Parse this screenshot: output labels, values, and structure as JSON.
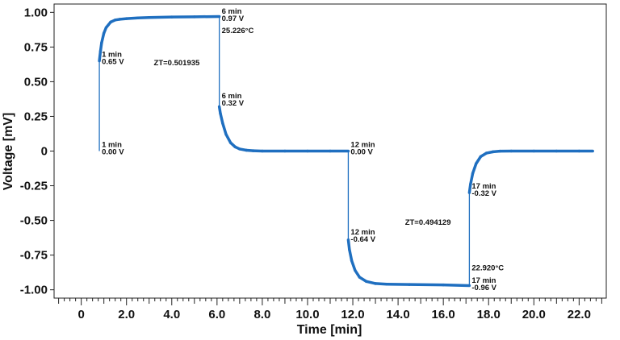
{
  "chart_data": {
    "type": "line",
    "title": "",
    "xlabel": "Time [min]",
    "ylabel": "Voltage [mV]",
    "xlim": [
      -1.2,
      23.2
    ],
    "ylim": [
      -1.06,
      1.06
    ],
    "x_ticks": [
      {
        "v": 0,
        "label": "0"
      },
      {
        "v": 2,
        "label": "2.0"
      },
      {
        "v": 4,
        "label": "4.0"
      },
      {
        "v": 6,
        "label": "6.0"
      },
      {
        "v": 8,
        "label": "8.0"
      },
      {
        "v": 10,
        "label": "10.0"
      },
      {
        "v": 12,
        "label": "12.0"
      },
      {
        "v": 14,
        "label": "14.0"
      },
      {
        "v": 16,
        "label": "16.0"
      },
      {
        "v": 18,
        "label": "18.0"
      },
      {
        "v": 20,
        "label": "20.0"
      },
      {
        "v": 22,
        "label": "22.0"
      }
    ],
    "y_ticks": [
      {
        "v": 1.0,
        "label": "1.00"
      },
      {
        "v": 0.75,
        "label": "0.75"
      },
      {
        "v": 0.5,
        "label": "0.50"
      },
      {
        "v": 0.25,
        "label": "0.25"
      },
      {
        "v": 0,
        "label": "0"
      },
      {
        "v": -0.25,
        "label": "-0.25"
      },
      {
        "v": -0.5,
        "label": "-0.50"
      },
      {
        "v": -0.75,
        "label": "-0.75"
      },
      {
        "v": -1.0,
        "label": "-1.00"
      }
    ],
    "grid": false,
    "color": "#1f6fc0",
    "series": [
      {
        "x": [
          0.8,
          0.8,
          0.85,
          0.9,
          1.0,
          1.1,
          1.2,
          1.3,
          1.5,
          1.7,
          2.0,
          2.5,
          3.0,
          4.0,
          5.0,
          6.1,
          6.1,
          6.15,
          6.25,
          6.4,
          6.6,
          6.8,
          7.0,
          7.3,
          7.6,
          8.0,
          9.0,
          10.0,
          11.0,
          11.8,
          11.8,
          11.85,
          11.95,
          12.1,
          12.3,
          12.6,
          13.0,
          13.5,
          14.5,
          16.0,
          17.15,
          17.15,
          17.2,
          17.3,
          17.45,
          17.65,
          17.9,
          18.2,
          18.5,
          19.0,
          20.0,
          21.0,
          22.0,
          22.6
        ],
        "y": [
          0.0,
          0.65,
          0.72,
          0.78,
          0.85,
          0.89,
          0.91,
          0.93,
          0.945,
          0.95,
          0.955,
          0.96,
          0.963,
          0.966,
          0.968,
          0.97,
          0.32,
          0.27,
          0.2,
          0.12,
          0.06,
          0.03,
          0.015,
          0.006,
          0.002,
          0.0,
          0.0,
          0.0,
          0.0,
          0.0,
          -0.64,
          -0.71,
          -0.79,
          -0.86,
          -0.91,
          -0.94,
          -0.955,
          -0.96,
          -0.962,
          -0.965,
          -0.97,
          -0.3,
          -0.24,
          -0.16,
          -0.09,
          -0.04,
          -0.015,
          -0.005,
          -0.001,
          0.0,
          0.0,
          0.0,
          0.0,
          0.0
        ]
      }
    ],
    "annotations": [
      {
        "x": 0.8,
        "y": 0.68,
        "lines": [
          "1 min",
          "0.65 V"
        ]
      },
      {
        "x": 0.8,
        "y": 0.03,
        "lines": [
          "1 min",
          "0.00 V"
        ]
      },
      {
        "x": 6.1,
        "y": 0.99,
        "lines": [
          "6 min",
          "0.97 V"
        ]
      },
      {
        "x": 6.1,
        "y": 0.85,
        "lines": [
          "25.226°C"
        ]
      },
      {
        "x": 6.1,
        "y": 0.38,
        "lines": [
          "6 min",
          "0.32 V"
        ]
      },
      {
        "x": 3.1,
        "y": 0.62,
        "lines": [
          "ZT=0.501935"
        ]
      },
      {
        "x": 11.8,
        "y": 0.03,
        "lines": [
          "12 min",
          "0.00 V"
        ]
      },
      {
        "x": 11.8,
        "y": -0.6,
        "lines": [
          "12 min",
          "-0.64 V"
        ]
      },
      {
        "x": 14.2,
        "y": -0.53,
        "lines": [
          "ZT=0.494129"
        ]
      },
      {
        "x": 17.15,
        "y": -0.27,
        "lines": [
          "17 min",
          "-0.32 V"
        ]
      },
      {
        "x": 17.15,
        "y": -0.86,
        "lines": [
          "22.920°C"
        ]
      },
      {
        "x": 17.15,
        "y": -0.95,
        "lines": [
          "17 min",
          "-0.96 V"
        ]
      }
    ]
  }
}
